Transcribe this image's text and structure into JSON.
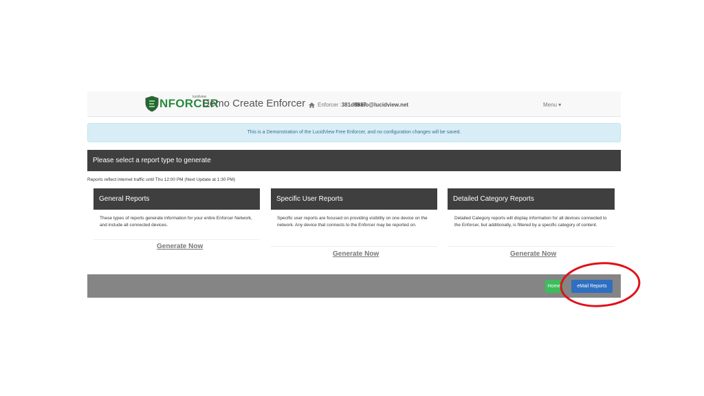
{
  "navbar": {
    "logo_small": "lucidview",
    "logo_text": "NFORCER",
    "title": "Demo Create Enforcer",
    "enforcer_label": "Enforcer :",
    "enforcer_id": "381d9837",
    "email": "demo@lucidview.net",
    "menu_label": "Menu",
    "home_icon": "home-icon",
    "caret_icon": "caret-down-icon"
  },
  "alert": {
    "text": "This is a Demonstration of the LucidView Free Enforcer, and no configuration changes will be saved."
  },
  "panel": {
    "heading": "Please select a report type to generate",
    "note": "Reports reflect internet traffic until Thu 12:00 PM (Next Update at 1:30 PM)"
  },
  "cards": [
    {
      "title": "General Reports",
      "body": "These types of reports generate information for your entire Enforcer Network, and include all connected devices.",
      "link": "Generate Now"
    },
    {
      "title": "Specific User Reports",
      "body": "Specific user reports are focused on providing visibility on one device on the network. Any device that connects to the Enforcer may be reported on.",
      "link": "Generate Now"
    },
    {
      "title": "Detailed Category Reports",
      "body": "Detailed Category reports will display information for all devices connected to the Enforcer, but additionally, is filtered by a specific category of content.",
      "link": "Generate Now"
    }
  ],
  "footer": {
    "home_label": "Home",
    "email_reports_label": "eMail Reports"
  },
  "colors": {
    "accent_green": "#3bbd5a",
    "accent_blue": "#2f6fc1",
    "highlight_red": "#e0101a"
  }
}
